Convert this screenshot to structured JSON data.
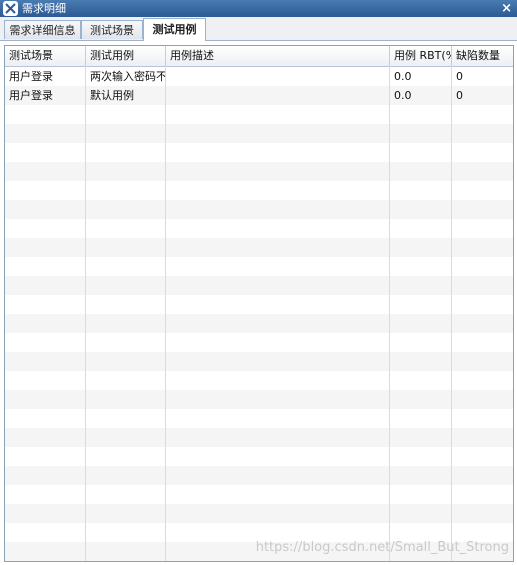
{
  "window": {
    "title": "需求明细",
    "close_glyph": "×"
  },
  "tabs": [
    {
      "label": "需求详细信息",
      "active": false
    },
    {
      "label": "测试场景",
      "active": false
    },
    {
      "label": "测试用例",
      "active": true
    }
  ],
  "table": {
    "columns": [
      "测试场景",
      "测试用例",
      "用例描述",
      "用例 RBT(%",
      "缺陷数量"
    ],
    "rows": [
      [
        "用户登录",
        "两次输入密码不一",
        "",
        "0.0",
        "0"
      ],
      [
        "用户登录",
        "默认用例",
        "",
        "0.0",
        "0"
      ]
    ]
  },
  "watermark": "https://blog.csdn.net/Small_But_Strong",
  "colors": {
    "titlebar": "#2c5a94",
    "row_stripe": "#f5f5f5",
    "border": "#8aa0bb"
  }
}
